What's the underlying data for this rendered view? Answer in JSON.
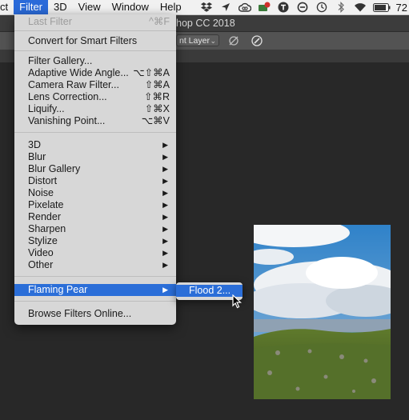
{
  "menubar": {
    "items": [
      {
        "label": "ct",
        "active": false
      },
      {
        "label": "Filter",
        "active": true
      },
      {
        "label": "3D",
        "active": false
      },
      {
        "label": "View",
        "active": false
      },
      {
        "label": "Window",
        "active": false
      },
      {
        "label": "Help",
        "active": false
      }
    ],
    "status_icons": [
      "dropbox-icon",
      "location-arrow-icon",
      "creative-cloud-icon",
      "mail-badge-icon",
      "t-circle-icon",
      "blocked-circle-icon",
      "time-machine-icon",
      "bluetooth-icon",
      "wifi-icon",
      "battery-icon"
    ],
    "clock": "72"
  },
  "photoshop": {
    "window_title": "hop CC 2018",
    "options_bar": {
      "layer_select_value": "nt Layer"
    }
  },
  "filter_menu": {
    "items": [
      {
        "label": "Last Filter",
        "shortcut": "^⌘F",
        "disabled": true
      },
      {
        "label": "Convert for Smart Filters",
        "shortcut": ""
      },
      {
        "label": "Filter Gallery...",
        "shortcut": ""
      },
      {
        "label": "Adaptive Wide Angle...",
        "shortcut": "⌥⇧⌘A"
      },
      {
        "label": "Camera Raw Filter...",
        "shortcut": "⇧⌘A"
      },
      {
        "label": "Lens Correction...",
        "shortcut": "⇧⌘R"
      },
      {
        "label": "Liquify...",
        "shortcut": "⇧⌘X"
      },
      {
        "label": "Vanishing Point...",
        "shortcut": "⌥⌘V"
      },
      {
        "label": "3D",
        "arrow": "▶"
      },
      {
        "label": "Blur",
        "arrow": "▶"
      },
      {
        "label": "Blur Gallery",
        "arrow": "▶"
      },
      {
        "label": "Distort",
        "arrow": "▶"
      },
      {
        "label": "Noise",
        "arrow": "▶"
      },
      {
        "label": "Pixelate",
        "arrow": "▶"
      },
      {
        "label": "Render",
        "arrow": "▶"
      },
      {
        "label": "Sharpen",
        "arrow": "▶"
      },
      {
        "label": "Stylize",
        "arrow": "▶"
      },
      {
        "label": "Video",
        "arrow": "▶"
      },
      {
        "label": "Other",
        "arrow": "▶"
      },
      {
        "label": "Flaming Pear",
        "arrow": "▶",
        "highlighted": true
      },
      {
        "label": "Browse Filters Online...",
        "shortcut": ""
      }
    ]
  },
  "flaming_pear_submenu": {
    "items": [
      {
        "label": "Flood 2...",
        "highlighted": true
      }
    ]
  },
  "colors": {
    "menu_highlight": "#2b6ed8",
    "menubar_active": "#2a6ad9",
    "menu_background": "#d7d7d7",
    "workspace": "#282828"
  }
}
